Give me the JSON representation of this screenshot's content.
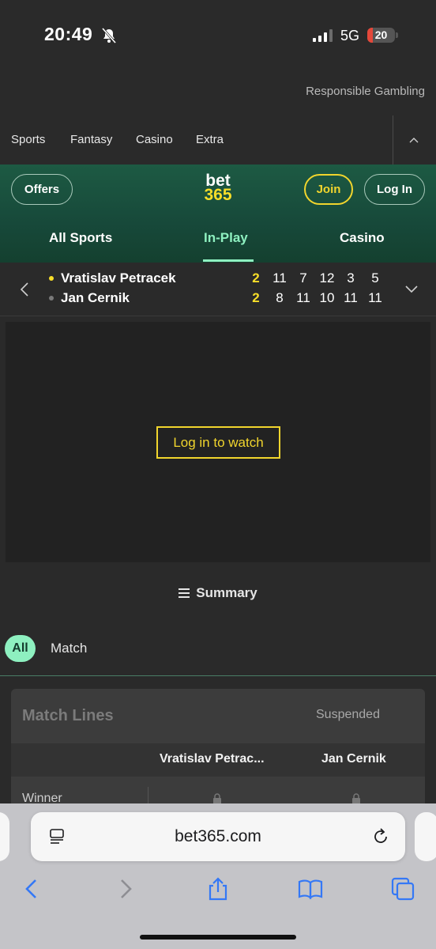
{
  "status_bar": {
    "time": "20:49",
    "network": "5G",
    "battery": "20",
    "battery_level": 0.2,
    "icons": [
      "bell-slash-icon",
      "signal-icon",
      "battery-icon"
    ]
  },
  "responsible_link": "Responsible Gambling",
  "top_nav": {
    "items": [
      "Sports",
      "Fantasy",
      "Casino",
      "Extra"
    ],
    "collapse_icon": "chevron-up-icon"
  },
  "header": {
    "offers_label": "Offers",
    "logo": {
      "line1": "bet",
      "line2": "365"
    },
    "join_label": "Join",
    "login_label": "Log In",
    "tabs": [
      "All Sports",
      "In-Play",
      "Casino"
    ],
    "active_tab": "In-Play"
  },
  "scoreboard": {
    "players": [
      {
        "name": "Vratislav Petracek",
        "serving": true,
        "sets": "2",
        "games": [
          "11",
          "7",
          "12",
          "3",
          "5"
        ]
      },
      {
        "name": "Jan Cernik",
        "serving": false,
        "sets": "2",
        "games": [
          "8",
          "11",
          "10",
          "11",
          "11"
        ]
      }
    ]
  },
  "video": {
    "watch_label": "Log in to watch"
  },
  "summary_label": "Summary",
  "filters": {
    "all_label": "All",
    "match_label": "Match"
  },
  "market": {
    "title": "Match Lines",
    "status": "Suspended",
    "col1": "Vratislav Petrac...",
    "col2": "Jan Cernik",
    "row_label": "Winner"
  },
  "browser": {
    "url": "bet365.com",
    "toolbar_icons": [
      "back-icon",
      "forward-icon",
      "share-icon",
      "bookmarks-icon",
      "tabs-icon"
    ]
  },
  "colors": {
    "accent_green": "#8ef0c0",
    "yellow": "#f1d52d",
    "header_green": "#1d5a43",
    "ios_blue": "#3478f6"
  }
}
